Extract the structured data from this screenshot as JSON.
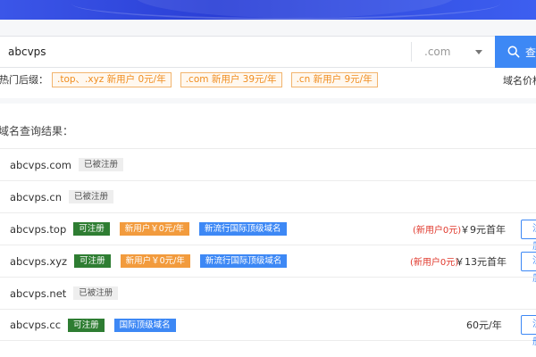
{
  "search": {
    "value": "abcvps",
    "suffix": ".com",
    "button_label": "查询"
  },
  "hot": {
    "label": "热门后缀：",
    "tags": [
      ".top、.xyz 新用户 0元/年",
      ".com 新用户 39元/年",
      ".cn 新用户 9元/年"
    ],
    "price_link": "域名价格"
  },
  "results": {
    "title": "域名查询结果：",
    "rows": [
      {
        "domain": "abcvps.com",
        "badges": [
          "已被注册"
        ]
      },
      {
        "domain": "abcvps.cn",
        "badges": [
          "已被注册"
        ]
      },
      {
        "domain": "abcvps.top",
        "badges": [
          "可注册",
          "新用户￥0元/年",
          "新流行国际顶级域名"
        ],
        "promo": "(新用户0元)",
        "price": "￥9元首年",
        "action": "注册"
      },
      {
        "domain": "abcvps.xyz",
        "badges": [
          "可注册",
          "新用户￥0元/年",
          "新流行国际顶级域名"
        ],
        "promo": "(新用户0元)",
        "price": "￥13元首年",
        "action": "注册"
      },
      {
        "domain": "abcvps.net",
        "badges": [
          "已被注册"
        ]
      },
      {
        "domain": "abcvps.cc",
        "badges": [
          "可注册",
          "国际顶级域名"
        ],
        "price": "60元/年",
        "action": "注册"
      }
    ]
  },
  "colors": {
    "accent": "#3d88f5",
    "available": "#2e7d32",
    "new_user": "#f29b3d",
    "promo_text": "#e0372b",
    "hot_tag": "#f08d1f"
  }
}
